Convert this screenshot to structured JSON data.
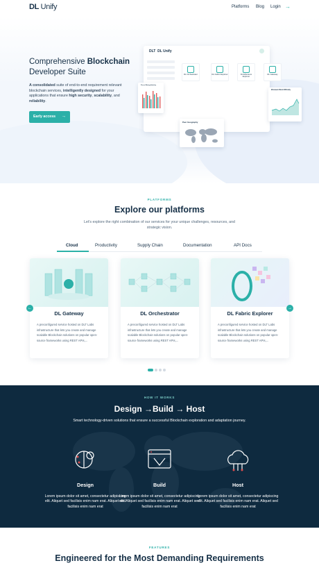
{
  "nav": {
    "logo_dl": "DL",
    "logo_unify": "Unify",
    "links": [
      "Platforms",
      "Blog",
      "Login"
    ],
    "login_arrow": "→"
  },
  "hero": {
    "title_plain_1": "Comprehensive ",
    "title_bold": "Blockchain",
    "title_plain_2": "Developer Suite",
    "desc_b1": "A consolidated",
    "desc_t1": " suite of end-to-end requirement relevant blockchain services, ",
    "desc_b2": "intelligently designed",
    "desc_t2": " for your applications that ensure ",
    "desc_b3": "high security",
    "desc_t3": ", ",
    "desc_b4": "scalability",
    "desc_t4": ", and ",
    "desc_b5": "reliability",
    "desc_t5": ".",
    "cta": "Early access",
    "cta_arrow": "→",
    "dashboard": {
      "logo_dlt": "DLT",
      "logo_dl": "DL Unify",
      "cards": [
        "DL Orchestrator",
        "DL Fabric Explorer",
        "DL Ethereum Explorer",
        "DL Gateway"
      ],
      "chart_title": "Ethereum Block Difficulty",
      "geo_title": "Peer Geography",
      "bar_title": "Peers Mining Activity"
    }
  },
  "platforms": {
    "tag": "PLATFORMS",
    "title": "Explore our platforms",
    "desc": "Let's explore the right combination of our services for your unique challenges, resources, and strategic vision.",
    "tabs": [
      "Cloud",
      "Productivity",
      "Supply Chain",
      "Documentation",
      "API Docs"
    ],
    "cards": [
      {
        "title": "DL Gateway",
        "desc": "A preconfigured service hosted on DLT Labs infrastructure that lets you create and manage scalable Blockchain solutions on popular open-source frameworks using REST APIs,..."
      },
      {
        "title": "DL Orchestrator",
        "desc": "A preconfigured service hosted on DLT Labs infrastructure that lets you create and manage scalable Blockchain solutions on popular open-source frameworks using REST APIs,..."
      },
      {
        "title": "DL Fabric Explorer",
        "desc": "A preconfigured service hosted on DLT Labs infrastructure that lets you create and manage scalable Blockchain solutions on popular open-source frameworks using REST APIs,..."
      }
    ],
    "prev": "←",
    "next": "→"
  },
  "how": {
    "tag": "HOW IT WORKS",
    "title": "Design →Build → Host",
    "desc": "Smart technology-driven solutions that ensure a successful Blockchain exploration and adaptation journey.",
    "steps": [
      {
        "title": "Design",
        "desc": "Lorem ipsum dolor sit amet, consectetur adipiscing elit. Aliquet sed facilisis enim nam erat. Aliquet sed facilisis enim nam erat"
      },
      {
        "title": "Build",
        "desc": "Lorem ipsum dolor sit amet, consectetur adipiscing elit. Aliquet sed facilisis enim nam erat. Aliquet sed facilisis enim nam erat"
      },
      {
        "title": "Host",
        "desc": "Lorem ipsum dolor sit amet, consectetur adipiscing elit. Aliquet sed facilisis enim nam erat. Aliquet sed facilisis enim nam erat"
      }
    ]
  },
  "features": {
    "tag": "FEATURES",
    "title": "Engineered for the Most Demanding Requirements"
  }
}
